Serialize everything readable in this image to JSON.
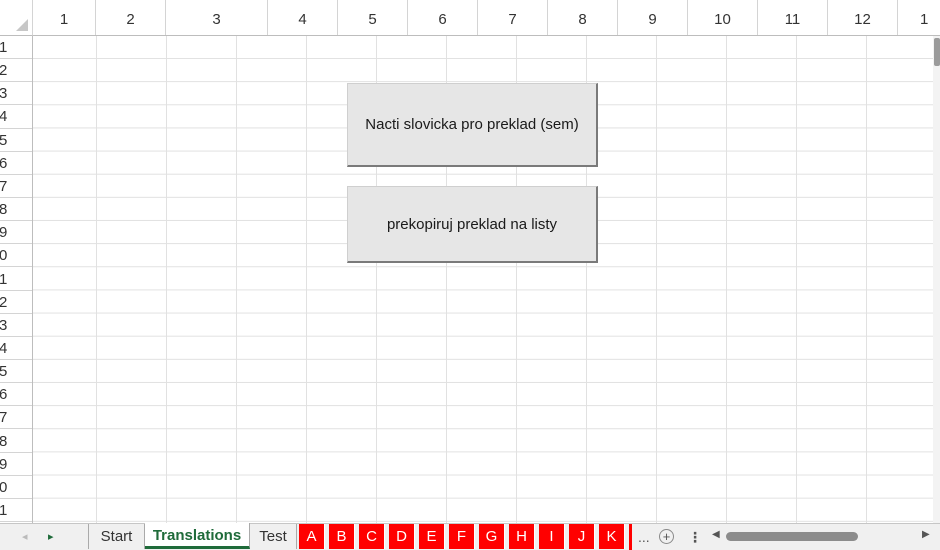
{
  "columns": [
    "1",
    "2",
    "3",
    "4",
    "5",
    "6",
    "7",
    "8",
    "9",
    "10",
    "11",
    "12",
    "1"
  ],
  "rows": [
    "1",
    "2",
    "3",
    "4",
    "5",
    "6",
    "7",
    "8",
    "9",
    "0",
    "1",
    "2",
    "3",
    "4",
    "5",
    "6",
    "7",
    "8",
    "9",
    "0",
    "1"
  ],
  "buttons": {
    "load_words": "Nacti slovicka pro preklad (sem)",
    "copy_translation": "prekopiruj preklad na listy"
  },
  "sheet_tabs": {
    "nav_left": "◂",
    "nav_right": "▸",
    "start": "Start",
    "translations": "Translations",
    "test": "Test",
    "letters": [
      "A",
      "B",
      "C",
      "D",
      "E",
      "F",
      "G",
      "H",
      "I",
      "J",
      "K"
    ],
    "more": "...",
    "add": "+",
    "options": "⋮"
  },
  "colors": {
    "active_tab": "#1f6b3a",
    "letter_tabs": "#ff0000"
  }
}
